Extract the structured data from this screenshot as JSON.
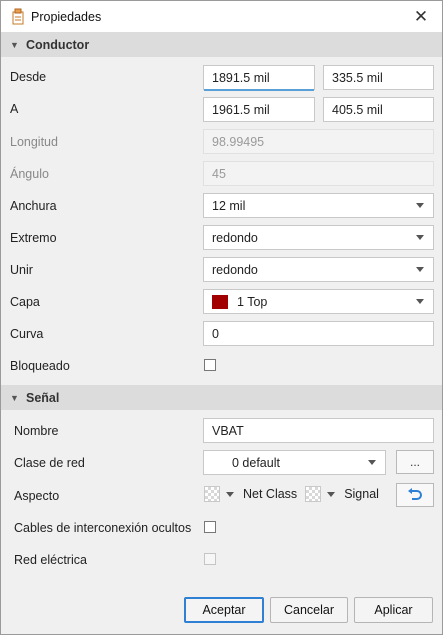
{
  "window": {
    "title": "Propiedades",
    "close_glyph": "✕"
  },
  "conductor": {
    "header": "Conductor",
    "desde": {
      "label": "Desde",
      "x": "1891.5 mil",
      "y": "335.5 mil"
    },
    "a": {
      "label": "A",
      "x": "1961.5 mil",
      "y": "405.5 mil"
    },
    "longitud": {
      "label": "Longitud",
      "value": "98.99495"
    },
    "angulo": {
      "label": "Ángulo",
      "value": "45"
    },
    "anchura": {
      "label": "Anchura",
      "value": "12 mil"
    },
    "extremo": {
      "label": "Extremo",
      "value": "redondo"
    },
    "unir": {
      "label": "Unir",
      "value": "redondo"
    },
    "capa": {
      "label": "Capa",
      "value": "1 Top",
      "swatch_color": "#a20000"
    },
    "curva": {
      "label": "Curva",
      "value": "0"
    },
    "bloqueado": {
      "label": "Bloqueado"
    }
  },
  "senal": {
    "header": "Señal",
    "nombre": {
      "label": "Nombre",
      "value": "VBAT"
    },
    "clase_red": {
      "label": "Clase de red",
      "value": "0 default",
      "more_button": "..."
    },
    "aspecto": {
      "label": "Aspecto",
      "net_class": "Net Class",
      "signal": "Signal"
    },
    "cables": {
      "label": "Cables de interconexión ocultos"
    },
    "red_electrica": {
      "label": "Red eléctrica"
    }
  },
  "footer": {
    "accept": "Aceptar",
    "cancel": "Cancelar",
    "apply": "Aplicar"
  },
  "colors": {
    "accent": "#2f7fd5",
    "layer_swatch": "#a20000"
  }
}
